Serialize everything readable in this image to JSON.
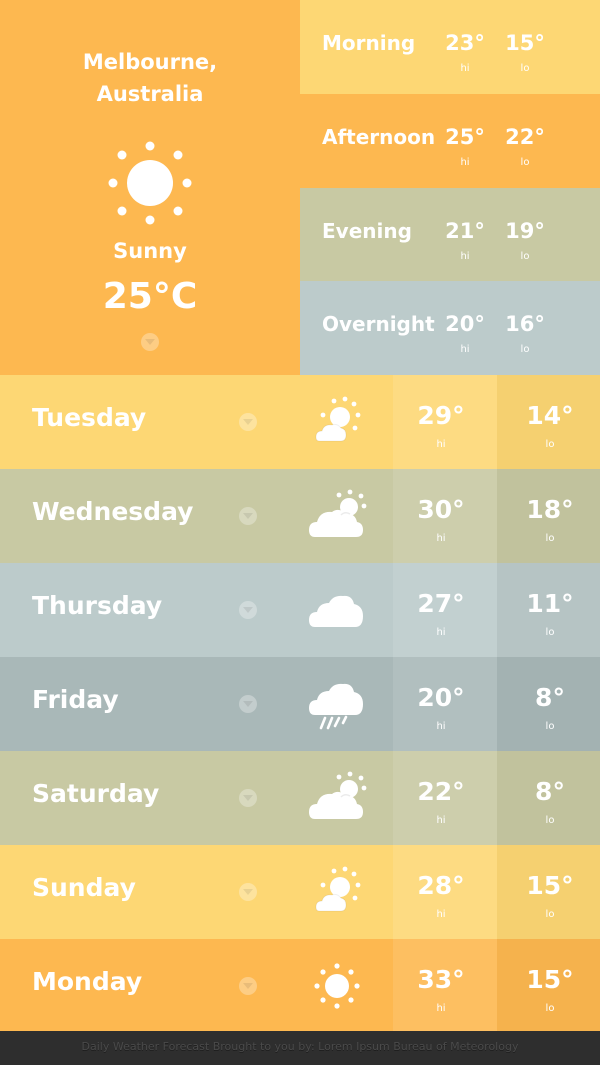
{
  "colors": {
    "orange": "#fdb850",
    "yellow": "#fdd774",
    "olive": "#c8c9a3",
    "bluegrey": "#bccbcb",
    "slate": "#a9b8b8",
    "footer": "#2e2e2e"
  },
  "current": {
    "city_line1": "Melbourne,",
    "city_line2": "Australia",
    "icon": "sun-icon",
    "condition": "Sunny",
    "temperature": "25°C"
  },
  "periods": [
    {
      "label": "Morning",
      "hi": "23°",
      "lo": "15°",
      "hi_label": "hi",
      "lo_label": "lo",
      "color": "#fdd774"
    },
    {
      "label": "Afternoon",
      "hi": "25°",
      "lo": "22°",
      "hi_label": "hi",
      "lo_label": "lo",
      "color": "#fdb850"
    },
    {
      "label": "Evening",
      "hi": "21°",
      "lo": "19°",
      "hi_label": "hi",
      "lo_label": "lo",
      "color": "#c8c9a3"
    },
    {
      "label": "Overnight",
      "hi": "20°",
      "lo": "16°",
      "hi_label": "hi",
      "lo_label": "lo",
      "color": "#bccbcb"
    }
  ],
  "days": [
    {
      "name": "Tuesday",
      "icon": "partly-sunny-icon",
      "hi": "29°",
      "lo": "14°",
      "hi_label": "hi",
      "lo_label": "lo",
      "color": "#fdd774"
    },
    {
      "name": "Wednesday",
      "icon": "partly-cloudy-icon",
      "hi": "30°",
      "lo": "18°",
      "hi_label": "hi",
      "lo_label": "lo",
      "color": "#c8c9a3"
    },
    {
      "name": "Thursday",
      "icon": "cloud-icon",
      "hi": "27°",
      "lo": "11°",
      "hi_label": "hi",
      "lo_label": "lo",
      "color": "#bccbcb"
    },
    {
      "name": "Friday",
      "icon": "rain-icon",
      "hi": "20°",
      "lo": "8°",
      "hi_label": "hi",
      "lo_label": "lo",
      "color": "#a9b8b8"
    },
    {
      "name": "Saturday",
      "icon": "partly-cloudy-icon",
      "hi": "22°",
      "lo": "8°",
      "hi_label": "hi",
      "lo_label": "lo",
      "color": "#c8c9a3"
    },
    {
      "name": "Sunday",
      "icon": "partly-sunny-icon",
      "hi": "28°",
      "lo": "15°",
      "hi_label": "hi",
      "lo_label": "lo",
      "color": "#fdd774"
    },
    {
      "name": "Monday",
      "icon": "sun-icon",
      "hi": "33°",
      "lo": "15°",
      "hi_label": "hi",
      "lo_label": "lo",
      "color": "#fdb850"
    }
  ],
  "footer": {
    "text": "Daily Weather Forecast Brought to you by: Lorem Ipsum Bureau of Meteorology"
  }
}
